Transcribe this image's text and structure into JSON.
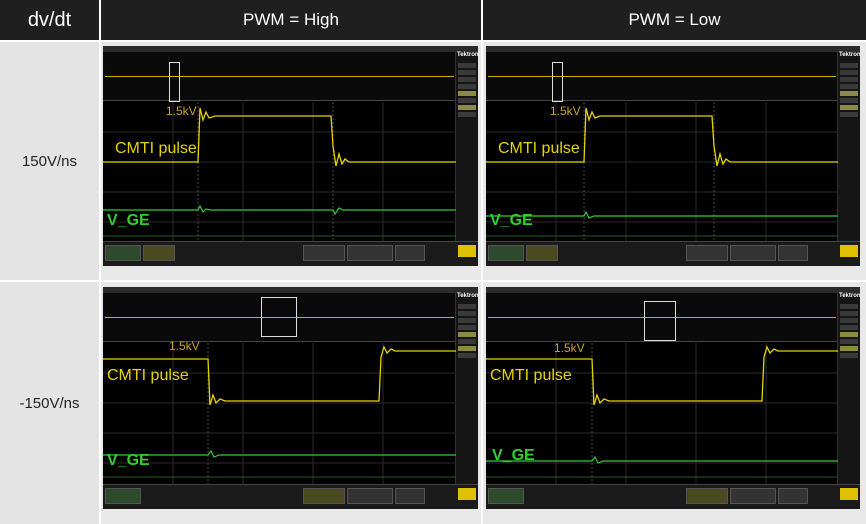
{
  "table": {
    "corner_label": "dv/dt",
    "columns": [
      "PWM = High",
      "PWM = Low"
    ],
    "rows": [
      "150V/ns",
      "-150V/ns"
    ]
  },
  "scope": {
    "brand": "Tektronix",
    "voltage_marker": "1.5kV",
    "labels": {
      "pulse": "CMTI pulse",
      "gate": "V_GE"
    },
    "colors": {
      "pulse": "#e6d400",
      "gate": "#33cc33",
      "background": "#000000"
    }
  }
}
